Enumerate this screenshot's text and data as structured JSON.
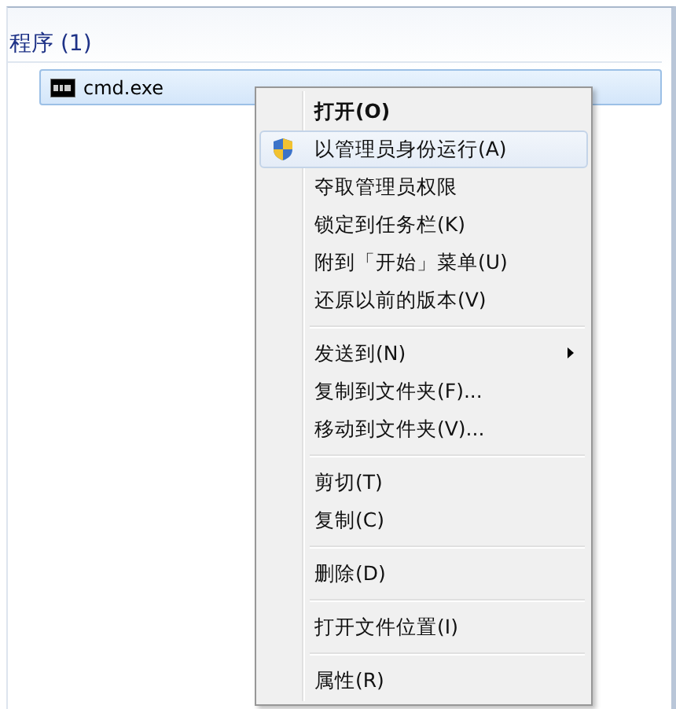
{
  "section": {
    "title": "程序 (1)"
  },
  "results": [
    {
      "label": "cmd.exe",
      "selected": true
    }
  ],
  "context_menu": {
    "groups": [
      [
        {
          "label": "打开(O)",
          "kind": "default",
          "selected": false
        },
        {
          "label": "以管理员身份运行(A)",
          "kind": "elevated",
          "selected": true
        },
        {
          "label": "夺取管理员权限",
          "kind": "plain",
          "selected": false
        },
        {
          "label": "锁定到任务栏(K)",
          "kind": "plain",
          "selected": false
        },
        {
          "label": "附到「开始」菜单(U)",
          "kind": "plain",
          "selected": false
        },
        {
          "label": "还原以前的版本(V)",
          "kind": "plain",
          "selected": false
        }
      ],
      [
        {
          "label": "发送到(N)",
          "kind": "submenu",
          "selected": false
        },
        {
          "label": "复制到文件夹(F)...",
          "kind": "plain",
          "selected": false
        },
        {
          "label": "移动到文件夹(V)...",
          "kind": "plain",
          "selected": false
        }
      ],
      [
        {
          "label": "剪切(T)",
          "kind": "plain",
          "selected": false
        },
        {
          "label": "复制(C)",
          "kind": "plain",
          "selected": false
        }
      ],
      [
        {
          "label": "删除(D)",
          "kind": "plain",
          "selected": false
        }
      ],
      [
        {
          "label": "打开文件位置(I)",
          "kind": "plain",
          "selected": false
        }
      ],
      [
        {
          "label": "属性(R)",
          "kind": "plain",
          "selected": false
        }
      ]
    ]
  }
}
